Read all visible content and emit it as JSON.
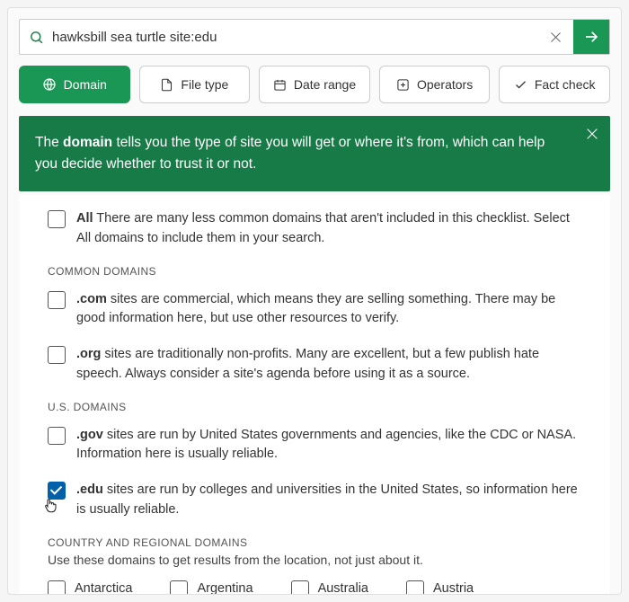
{
  "search": {
    "value": "hawksbill sea turtle site:edu"
  },
  "filters": {
    "domain": "Domain",
    "filetype": "File type",
    "daterange": "Date range",
    "operators": "Operators",
    "factcheck": "Fact check"
  },
  "banner": {
    "prefix": "The ",
    "keyword": "domain",
    "suffix": " tells you the type of site you will get or where it's from, which can help you decide whether to trust it or not."
  },
  "sections": {
    "all": {
      "label": "All",
      "desc": " There are many less common domains that aren't included in this checklist. Select All domains to include them in your search."
    },
    "common_header": "COMMON DOMAINS",
    "com": {
      "label": ".com",
      "desc": " sites are commercial, which means they are selling something. There may be good information here, but use other resources to verify."
    },
    "org": {
      "label": ".org",
      "desc": " sites are traditionally non-profits. Many are excellent, but a few publish hate speech. Always consider a site's agenda before using it as a source."
    },
    "us_header": "U.S. DOMAINS",
    "gov": {
      "label": ".gov",
      "desc": " sites are run by United States governments and agencies, like the CDC or NASA. Information here is usually reliable."
    },
    "edu": {
      "label": ".edu",
      "desc": " sites are run by colleges and universities in the United States, so information here is usually reliable."
    },
    "country_header": "COUNTRY AND REGIONAL DOMAINS",
    "country_sub": "Use these domains to get results from the location, not just about it.",
    "countries": {
      "antarctica": "Antarctica",
      "argentina": "Argentina",
      "australia": "Australia",
      "austria": "Austria"
    }
  }
}
